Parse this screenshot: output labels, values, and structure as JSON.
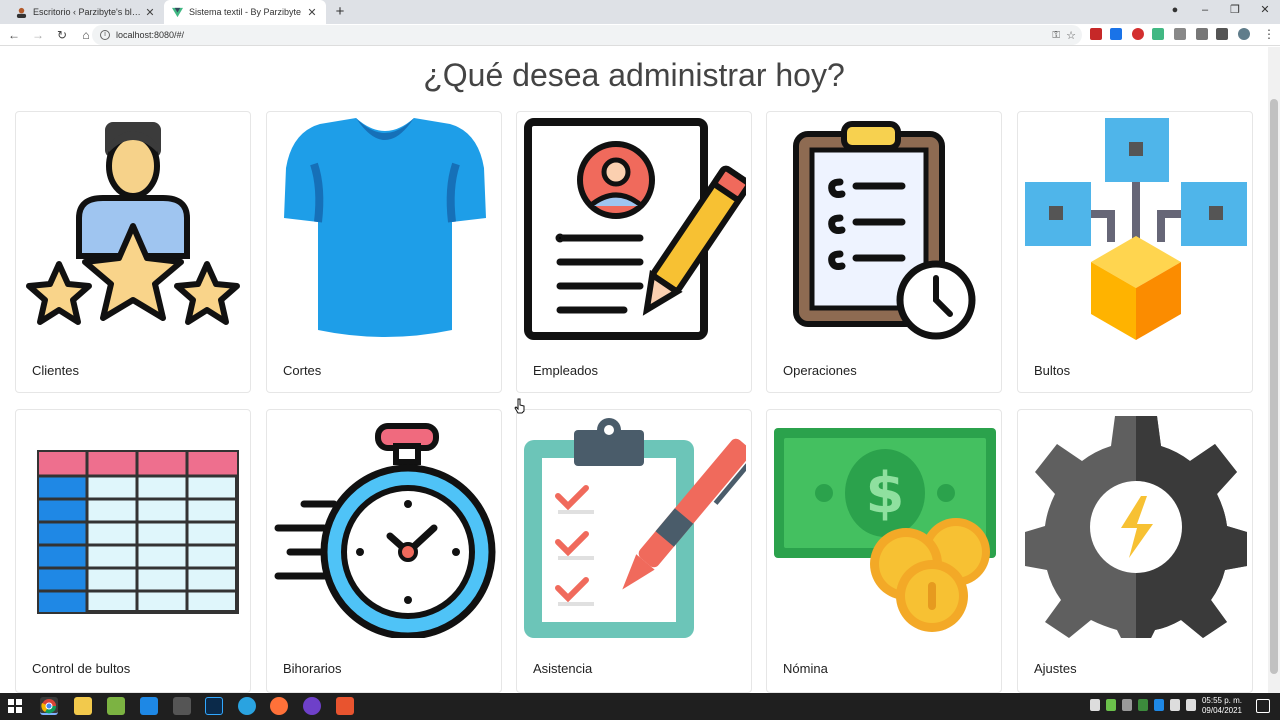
{
  "browser": {
    "tabs": [
      {
        "title": "Escritorio ‹ Parzibyte's blog — W",
        "active": false
      },
      {
        "title": "Sistema textil - By Parzibyte",
        "active": true
      }
    ],
    "url": "localhost:8080/#/",
    "window_controls": [
      "–",
      "❐",
      "✕"
    ]
  },
  "page": {
    "heading": "¿Qué desea administrar hoy?",
    "cards": [
      {
        "label": "Clientes",
        "icon": "customer-rating-icon"
      },
      {
        "label": "Cortes",
        "icon": "tshirt-icon"
      },
      {
        "label": "Empleados",
        "icon": "resume-icon"
      },
      {
        "label": "Operaciones",
        "icon": "clipboard-clock-icon"
      },
      {
        "label": "Bultos",
        "icon": "network-cube-icon"
      },
      {
        "label": "Control de bultos",
        "icon": "spreadsheet-icon"
      },
      {
        "label": "Bihorarios",
        "icon": "stopwatch-icon"
      },
      {
        "label": "Asistencia",
        "icon": "checklist-icon"
      },
      {
        "label": "Nómina",
        "icon": "money-icon"
      },
      {
        "label": "Ajustes",
        "icon": "gear-icon"
      }
    ]
  },
  "taskbar": {
    "time": "05:55 p. m.",
    "date": "09/04/2021"
  },
  "colors": {
    "chrome_tabstrip": "#dee1e6",
    "taskbar": "#1f1f1f",
    "tshirt": "#1e9ee8",
    "money_green": "#2ba24c",
    "coin_gold": "#f7c133",
    "gear_gray": "#5f5f5f",
    "table_pink": "#ee6f8e",
    "table_blue": "#1f88e5"
  }
}
